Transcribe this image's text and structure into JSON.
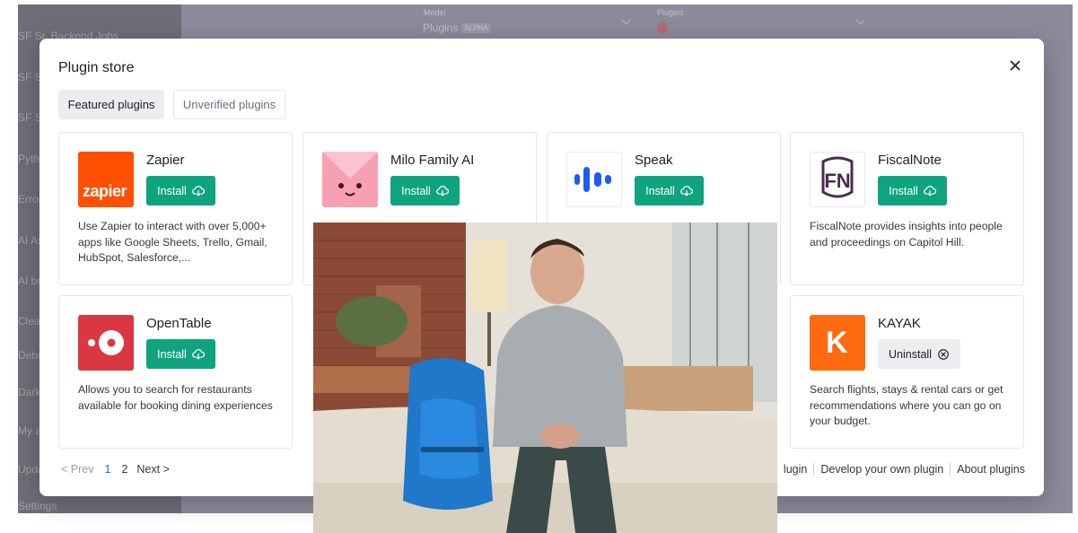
{
  "background": {
    "sidebar_items": [
      "SF Sr. Backend Jobs",
      "SF St...",
      "SF St...",
      "Pytho...",
      "Error...",
      "AI As...",
      "AI bo...",
      "Clean...",
      "Debu...",
      "Dark ...",
      "My a...",
      "Upda...",
      "Settings"
    ],
    "model_label": "Model",
    "model_value": "Plugins",
    "model_badge": "ALPHA",
    "plugins_label": "Plugins"
  },
  "modal": {
    "title": "Plugin store",
    "tabs": [
      "Featured plugins",
      "Unverified plugins"
    ],
    "plugins": [
      {
        "name": "Zapier",
        "button": "Install",
        "description": "Use Zapier to interact with over 5,000+ apps like Google Sheets, Trello, Gmail, HubSpot, Salesforce,...",
        "logo_text": "zapier"
      },
      {
        "name": "Milo Family AI",
        "button": "Install",
        "description": ""
      },
      {
        "name": "Speak",
        "button": "Install",
        "description": ""
      },
      {
        "name": "FiscalNote",
        "button": "Install",
        "description": "FiscalNote provides insights into people and proceedings on Capitol Hill.",
        "logo_text": "FN"
      },
      {
        "name": "OpenTable",
        "button": "Install",
        "description": "Allows you to search for restaurants available for booking dining experiences"
      },
      {
        "name": "KAYAK",
        "button": "Uninstall",
        "description": "Search flights, stays & rental cars or get recommendations where you can go on your budget.",
        "logo_text": "K"
      }
    ],
    "pagination": {
      "prev": "< Prev",
      "pages": [
        "1",
        "2"
      ],
      "next": "Next >"
    },
    "footer_links": [
      "lugin",
      "Develop your own plugin",
      "About plugins"
    ]
  },
  "colors": {
    "install_green": "#10a37f",
    "zapier_orange": "#ff4f00",
    "opentable_red": "#da3743",
    "kayak_orange": "#ff690f",
    "fiscalnote_purple": "#4a2b4f",
    "speak_blue": "#1f5cf5",
    "milo_pink": "#f78fa7"
  }
}
